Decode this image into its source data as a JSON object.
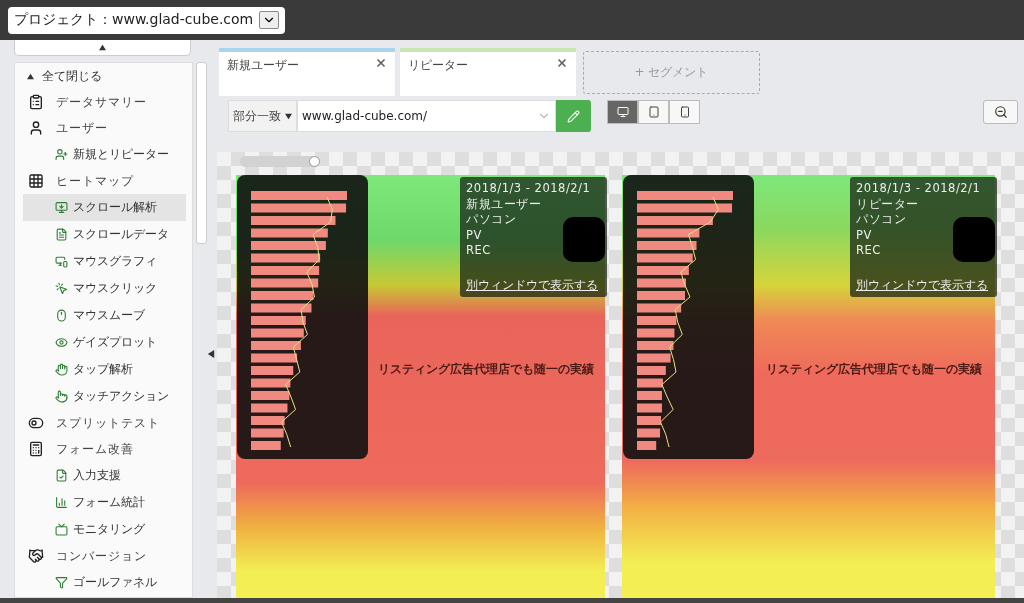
{
  "project": {
    "label": "プロジェクト：www.glad-cube.com"
  },
  "sidebar": {
    "collapse_all": "全て閉じる",
    "items": [
      {
        "label": "データサマリー",
        "selected": false
      },
      {
        "label": "ユーザー",
        "selected": false,
        "children": [
          {
            "label": "新規とリピーター",
            "selected": false
          }
        ]
      },
      {
        "label": "ヒートマップ",
        "selected": false,
        "children": [
          {
            "label": "スクロール解析",
            "selected": true
          },
          {
            "label": "スクロールデータ",
            "selected": false
          },
          {
            "label": "マウスグラフィ",
            "selected": false
          },
          {
            "label": "マウスクリック",
            "selected": false
          },
          {
            "label": "マウスムーブ",
            "selected": false
          },
          {
            "label": "ゲイズプロット",
            "selected": false
          },
          {
            "label": "タップ解析",
            "selected": false
          },
          {
            "label": "タッチアクション",
            "selected": false
          }
        ]
      },
      {
        "label": "スプリットテスト",
        "selected": false
      },
      {
        "label": "フォーム改善",
        "selected": false,
        "children": [
          {
            "label": "入力支援",
            "selected": false
          },
          {
            "label": "フォーム統計",
            "selected": false
          },
          {
            "label": "モニタリング",
            "selected": false
          }
        ]
      },
      {
        "label": "コンバージョン",
        "selected": false,
        "children": [
          {
            "label": "ゴールファネル",
            "selected": false
          }
        ]
      }
    ]
  },
  "segments": [
    {
      "label": "新規ユーザー",
      "color": "#a9d4ee"
    },
    {
      "label": "リピーター",
      "color": "#c8e6b0"
    }
  ],
  "add_segment": "+ セグメント",
  "filter": {
    "match": "部分一致",
    "url": "www.glad-cube.com/"
  },
  "devices": [
    {
      "selected": true
    },
    {
      "selected": false
    },
    {
      "selected": false
    }
  ],
  "zoom_slider": {
    "level": 1
  },
  "heatmaps": [
    {
      "date_range": "2018/1/3 - 2018/2/1",
      "segment": "新規ユーザー",
      "device": "パソコン",
      "metric": "PV",
      "mode": "REC",
      "link": "別ウィンドウで表示する",
      "heading": "リスティング広告代理店でも随一の実績"
    },
    {
      "date_range": "2018/1/3 - 2018/2/1",
      "segment": "リピーター",
      "device": "パソコン",
      "metric": "PV",
      "mode": "REC",
      "link": "別ウィンドウで表示する",
      "heading": "リスティング広告代理店でも随一の実績"
    }
  ]
}
